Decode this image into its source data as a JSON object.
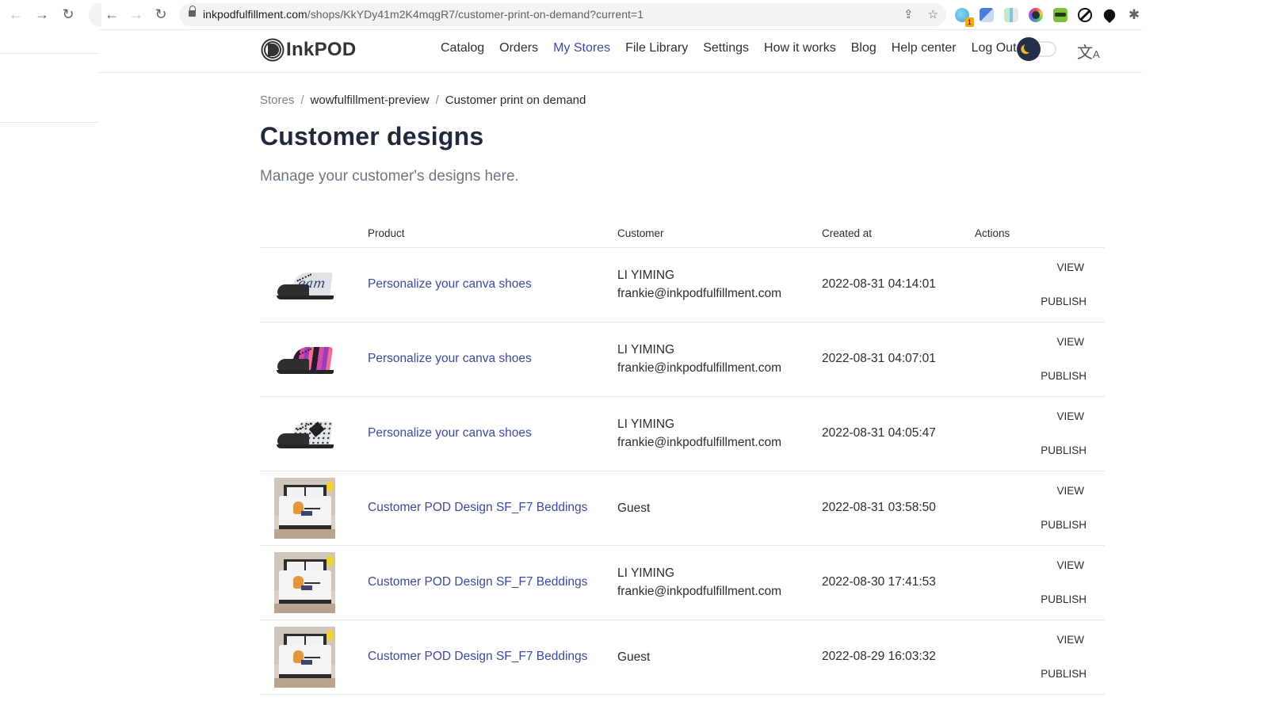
{
  "browser": {
    "url_host": "inkpodfulfillment.com",
    "url_path": "/shops/KkYDy41m2K4mqgR7/customer-print-on-demand?current=1",
    "extension_badge": "1"
  },
  "header": {
    "logo_text": "InkPOD",
    "nav": [
      {
        "label": "Catalog",
        "active": false
      },
      {
        "label": "Orders",
        "active": false
      },
      {
        "label": "My Stores",
        "active": true
      },
      {
        "label": "File Library",
        "active": false
      },
      {
        "label": "Settings",
        "active": false
      },
      {
        "label": "How it works",
        "active": false
      },
      {
        "label": "Blog",
        "active": false
      },
      {
        "label": "Help center",
        "active": false
      },
      {
        "label": "Log Out",
        "active": false
      }
    ],
    "dark_mode_toggle": "moon-icon",
    "language_icon": "translate-icon"
  },
  "breadcrumb": {
    "items": [
      "Stores",
      "wowfulfillment-preview",
      "Customer print on demand"
    ],
    "separator": "/"
  },
  "page": {
    "title": "Customer designs",
    "subtitle": "Manage your customer's designs here."
  },
  "table": {
    "columns": [
      "",
      "Product",
      "Customer",
      "Created at",
      "Actions"
    ],
    "view_label": "VIEW",
    "publish_label": "PUBLISH",
    "rows": [
      {
        "thumb": "shoe-dream",
        "product": "Personalize your canva shoes",
        "customer_name": "LI YIMING",
        "customer_email": "frankie@inkpodfulfillment.com",
        "created_at": "2022-08-31 04:14:01"
      },
      {
        "thumb": "shoe-pink",
        "product": "Personalize your canva shoes",
        "customer_name": "LI YIMING",
        "customer_email": "frankie@inkpodfulfillment.com",
        "created_at": "2022-08-31 04:07:01"
      },
      {
        "thumb": "shoe-dots",
        "product": "Personalize your canva shoes",
        "customer_name": "LI YIMING",
        "customer_email": "frankie@inkpodfulfillment.com",
        "created_at": "2022-08-31 04:05:47"
      },
      {
        "thumb": "bedding",
        "product": "Customer POD Design SF_F7 Beddings",
        "customer_name": "Guest",
        "customer_email": "",
        "created_at": "2022-08-31 03:58:50"
      },
      {
        "thumb": "bedding",
        "product": "Customer POD Design SF_F7 Beddings",
        "customer_name": "LI YIMING",
        "customer_email": "frankie@inkpodfulfillment.com",
        "created_at": "2022-08-30 17:41:53"
      },
      {
        "thumb": "bedding",
        "product": "Customer POD Design SF_F7 Beddings",
        "customer_name": "Guest",
        "customer_email": "",
        "created_at": "2022-08-29 16:03:32"
      }
    ]
  },
  "colors": {
    "accent_link": "#3c4a9c",
    "title": "#1f2a3c",
    "subtitle": "#6c7687",
    "toggle_knob": "#243049",
    "moon": "#f2b824"
  }
}
